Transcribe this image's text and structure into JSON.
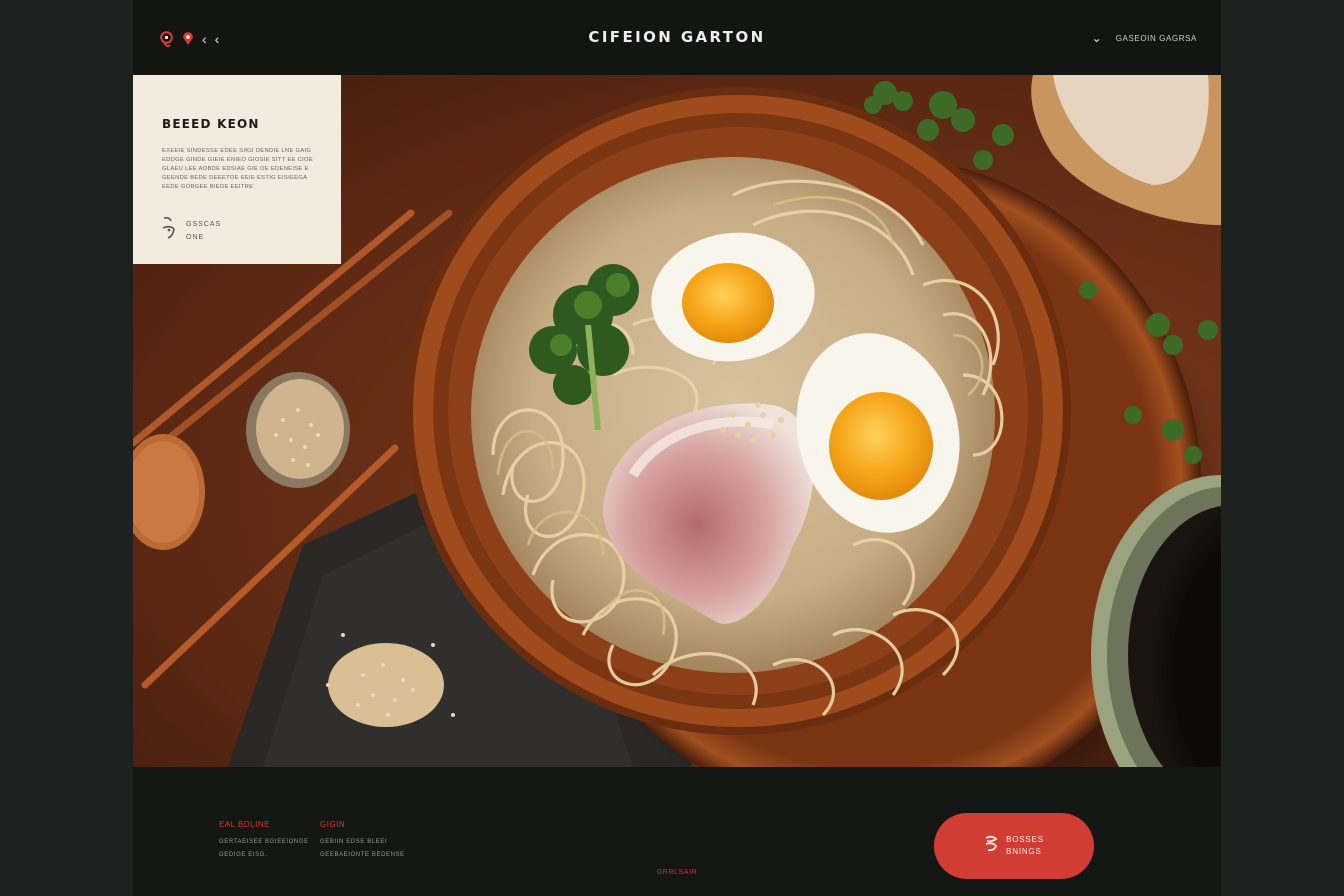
{
  "header": {
    "brand": "CIFEION GARTON",
    "menu_label": "GASEOIN GAGRSA",
    "left_icons": [
      "logo-icon",
      "map-pin-icon",
      "chevron-left-icon",
      "chevron-left-icon"
    ],
    "right_icons": [
      "chevron-down-icon"
    ]
  },
  "card": {
    "title": "BEEED KEON",
    "description": "EXEEIE SINDESSE EDEE SIKU DENDIE LNE GAIG EDDGE GINDE GIEIE ENIEO GIOSIE SITT EE CIOE GLAEU LEE AOBDE EDSIAE GIE OE EDENEISE E GEENDE BEDE DEEETOE EEIE ESTIG EISIEEGA EEDE GOBGEE BIEDE EEITRE",
    "meta_line1": "GSSCAS",
    "meta_line2": "ONE"
  },
  "footer": {
    "col1": {
      "heading": "EAL BDLINE",
      "text": "GERTAEISEE BGIEEIONGE",
      "text2": "GEDIGE EISG."
    },
    "col2": {
      "heading": "GIGIN",
      "text": "GEBIIN EDSE BLEEI",
      "text2": "GEEBAEIONTE BEDENSE"
    },
    "cta_line1": "BOSSES",
    "cta_line2": "BNINGS",
    "copyright": "GRRLSAIR"
  },
  "colors": {
    "accent_red": "#d13c33",
    "background": "#141614",
    "card": "#f3ebde",
    "table_wood": "#6e3318"
  }
}
